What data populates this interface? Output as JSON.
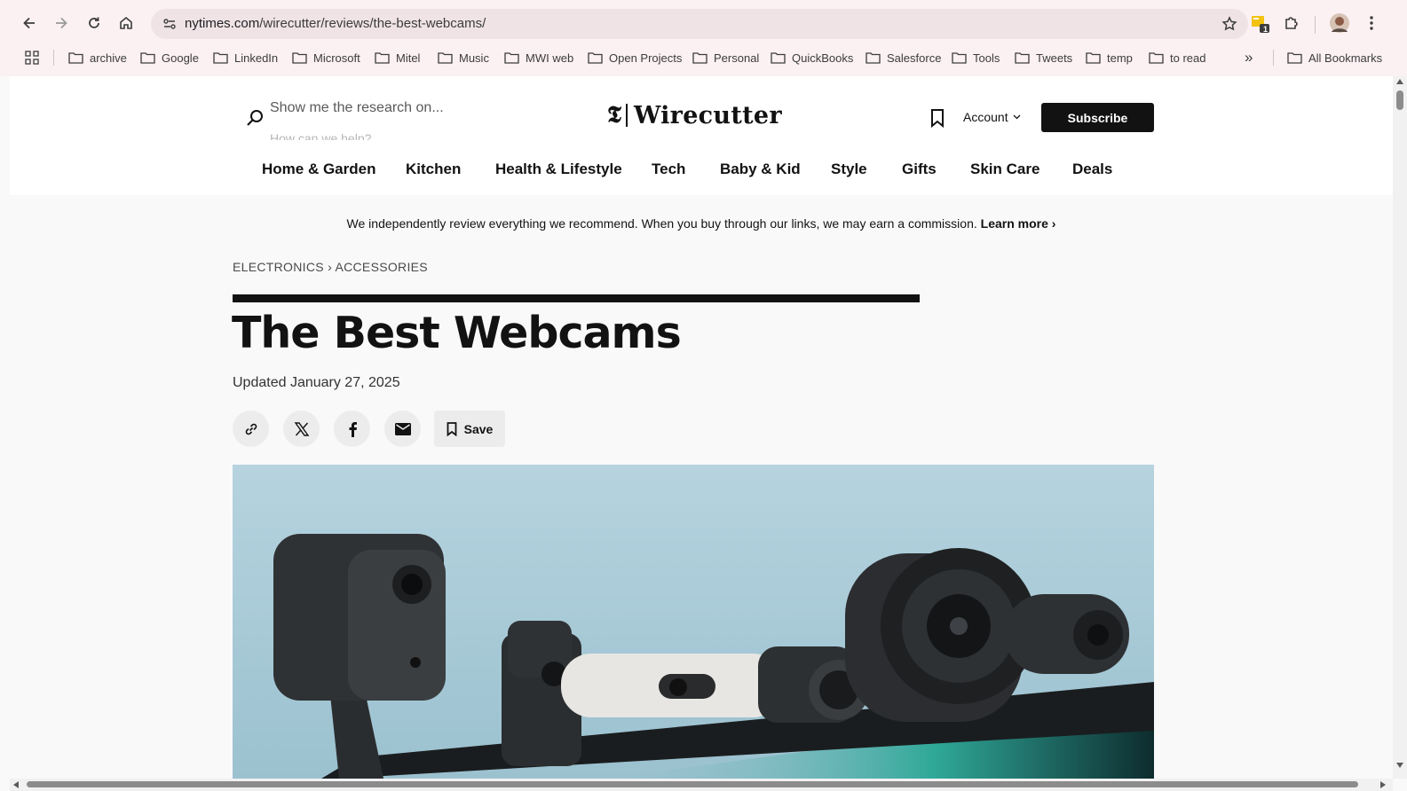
{
  "browser": {
    "url_domain": "nytimes.com",
    "url_path": "/wirecutter/reviews/the-best-webcams/",
    "extension_badge": "1",
    "bookmarks": [
      "archive",
      "Google",
      "LinkedIn",
      "Microsoft",
      "Mitel",
      "Music",
      "MWI web",
      "Open Projects",
      "Personal",
      "QuickBooks",
      "Salesforce",
      "Tools",
      "Tweets",
      "temp",
      "to read"
    ],
    "overflow_label": "»",
    "all_bookmarks": "All Bookmarks"
  },
  "header": {
    "search_placeholder": "Show me the research on...",
    "search_hint": "How can we help?",
    "logo_mark": "𝕿",
    "logo_text": "Wirecutter",
    "account_label": "Account",
    "subscribe_label": "Subscribe"
  },
  "nav": [
    "Home & Garden",
    "Kitchen",
    "Health & Lifestyle",
    "Tech",
    "Baby & Kid",
    "Style",
    "Gifts",
    "Skin Care",
    "Deals"
  ],
  "article": {
    "disclosure": "We independently review everything we recommend. When you buy through our links, we may earn a commission.",
    "learn_more": "Learn more ›",
    "breadcrumb_1": "ELECTRONICS",
    "breadcrumb_sep": "›",
    "breadcrumb_2": "ACCESSORIES",
    "title": "The Best Webcams",
    "updated": "Updated January 27, 2025",
    "save_label": "Save"
  },
  "colors": {
    "chrome_bg": "#fbf0f2",
    "page_bg": "#f9f9f9",
    "ink": "#121212",
    "hero_bg": "#a9ccd9"
  }
}
